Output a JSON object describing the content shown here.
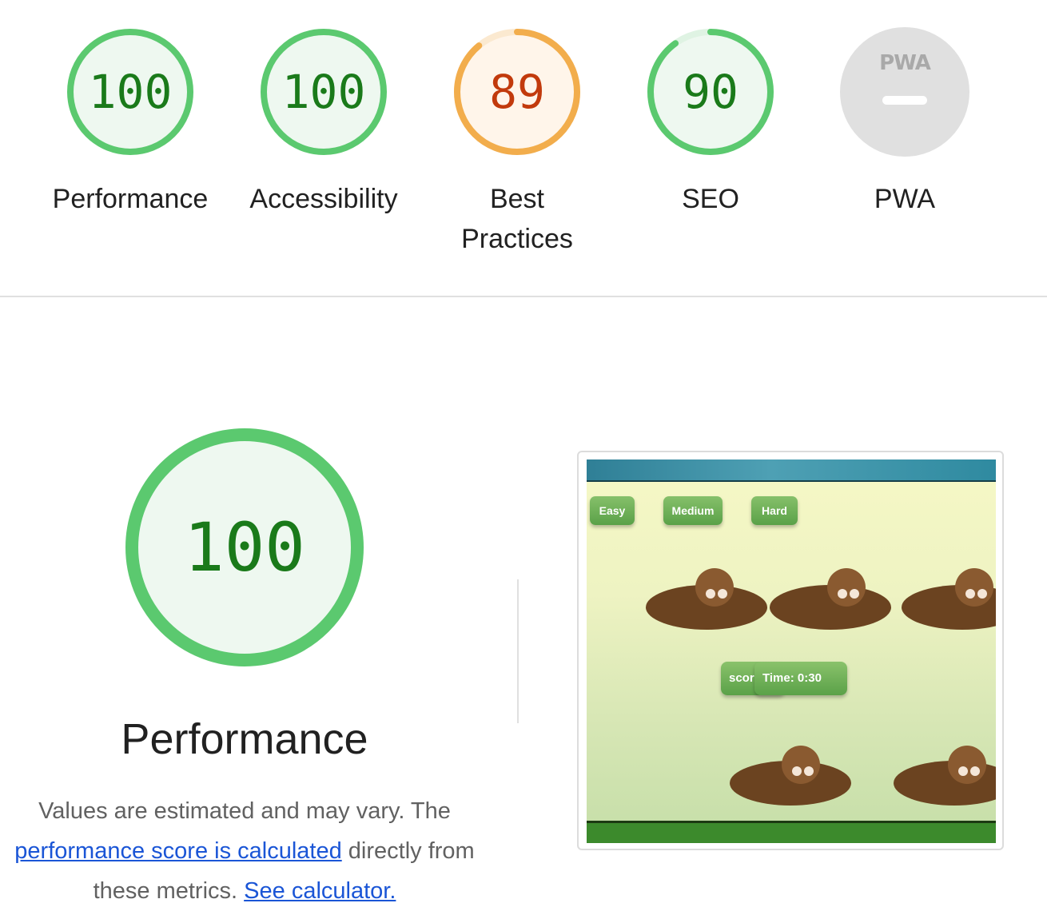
{
  "gauges": [
    {
      "label": "Performance",
      "score": "100",
      "value": 100,
      "status": "pass"
    },
    {
      "label": "Accessibility",
      "score": "100",
      "value": 100,
      "status": "pass"
    },
    {
      "label": "Best Practices",
      "score": "89",
      "value": 89,
      "status": "average"
    },
    {
      "label": "SEO",
      "score": "90",
      "value": 90,
      "status": "pass"
    },
    {
      "label": "PWA",
      "logo": "PWA",
      "status": "not-applicable"
    }
  ],
  "colors": {
    "pass": "#0cce6b",
    "pass_text": "#1a7a1a",
    "pass_bg": "#eef8f0",
    "average": "#ffa400",
    "average_text": "#c23a0c",
    "average_bg": "#fff5ea",
    "na": "#e0e0e0",
    "link": "#1a55d6"
  },
  "performance": {
    "score": "100",
    "title": "Performance",
    "desc_before": "Values are estimated and may vary. The ",
    "desc_link": "performance score is calculated",
    "desc_middle": " directly from these metrics. ",
    "calc_link": "See calculator."
  },
  "screenshot": {
    "buttons": [
      "Easy",
      "Medium",
      "Hard"
    ],
    "score_label": "scor",
    "timer": "Time: 0:30"
  }
}
